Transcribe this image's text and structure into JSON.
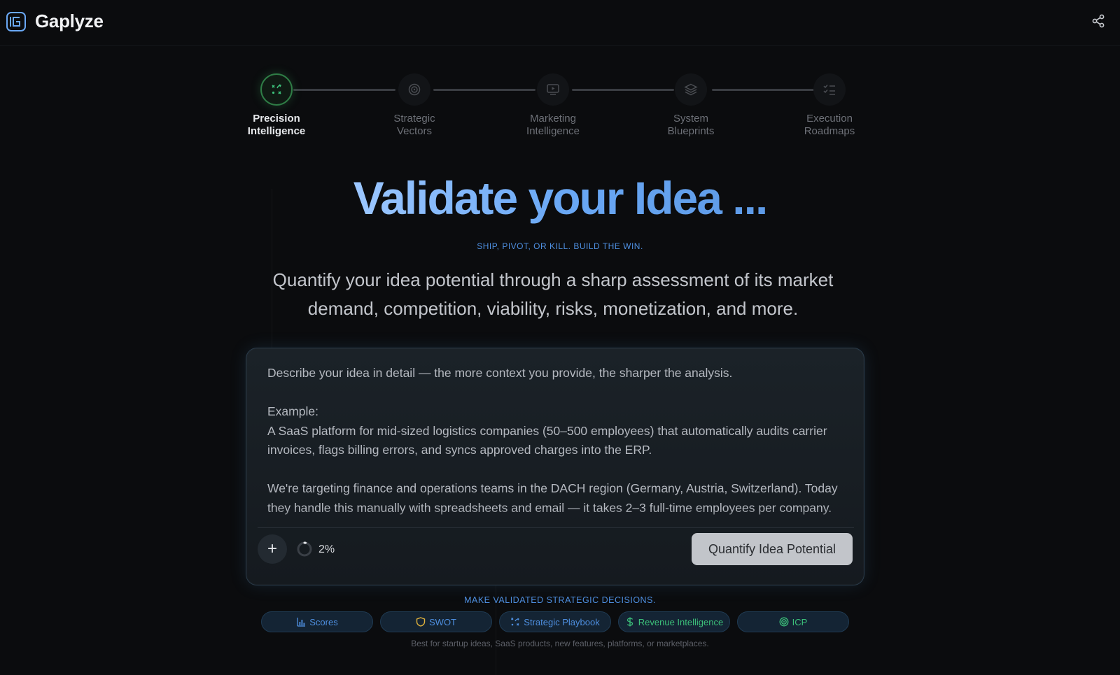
{
  "app": {
    "name": "Gaplyze"
  },
  "steps": [
    {
      "label": "Precision Intelligence",
      "line1": "Precision",
      "line2": "Intelligence",
      "active": true,
      "icon": "sparkle-arrows-icon"
    },
    {
      "label": "Strategic Vectors",
      "line1": "Strategic",
      "line2": "Vectors",
      "active": false,
      "icon": "target-icon"
    },
    {
      "label": "Marketing Intelligence",
      "line1": "Marketing",
      "line2": "Intelligence",
      "active": false,
      "icon": "monitor-play-icon"
    },
    {
      "label": "System Blueprints",
      "line1": "System",
      "line2": "Blueprints",
      "active": false,
      "icon": "layers-icon"
    },
    {
      "label": "Execution Roadmaps",
      "line1": "Execution",
      "line2": "Roadmaps",
      "active": false,
      "icon": "checklist-icon"
    }
  ],
  "hero": {
    "title": "Validate your Idea ...",
    "tagline": "SHIP, PIVOT, OR KILL. BUILD THE WIN.",
    "description": "Quantify your idea potential through a sharp assessment of its market demand, competition, viability, risks, monetization, and more."
  },
  "input": {
    "placeholder_line1": "Describe your idea in detail — the more context you provide, the sharper the analysis.",
    "example_label": "Example:",
    "example_p1": "A SaaS platform for mid-sized logistics companies (50–500 employees) that automatically audits carrier invoices, flags billing errors, and syncs approved charges into the ERP.",
    "example_p2": "We're targeting finance and operations teams in the DACH region (Germany, Austria, Switzerland). Today they handle this manually with spreadsheets and email — it takes 2–3 full-time employees per company.",
    "progress_label": "2%",
    "progress_value": 0.02,
    "submit_label": "Quantify Idea Potential"
  },
  "features": {
    "label": "MAKE VALIDATED STRATEGIC DECISIONS.",
    "chips": [
      {
        "label": "Scores",
        "icon": "bar-chart-icon",
        "color": "#4e8fe0"
      },
      {
        "label": "SWOT",
        "icon": "shield-icon",
        "color": "#e0b23c"
      },
      {
        "label": "Strategic Playbook",
        "icon": "sparkle-arrows-icon",
        "color": "#4e8fe0"
      },
      {
        "label": "Revenue Intelligence",
        "icon": "dollar-icon",
        "color": "#3cc07a"
      },
      {
        "label": "ICP",
        "icon": "target-icon",
        "color": "#3cc07a"
      }
    ],
    "footnote": "Best for startup ideas, SaaS products, new features, platforms, or marketplaces."
  },
  "colors": {
    "background": "#0b0c0e",
    "accent_blue": "#4e8fe0",
    "active_green": "#2f7d46"
  }
}
